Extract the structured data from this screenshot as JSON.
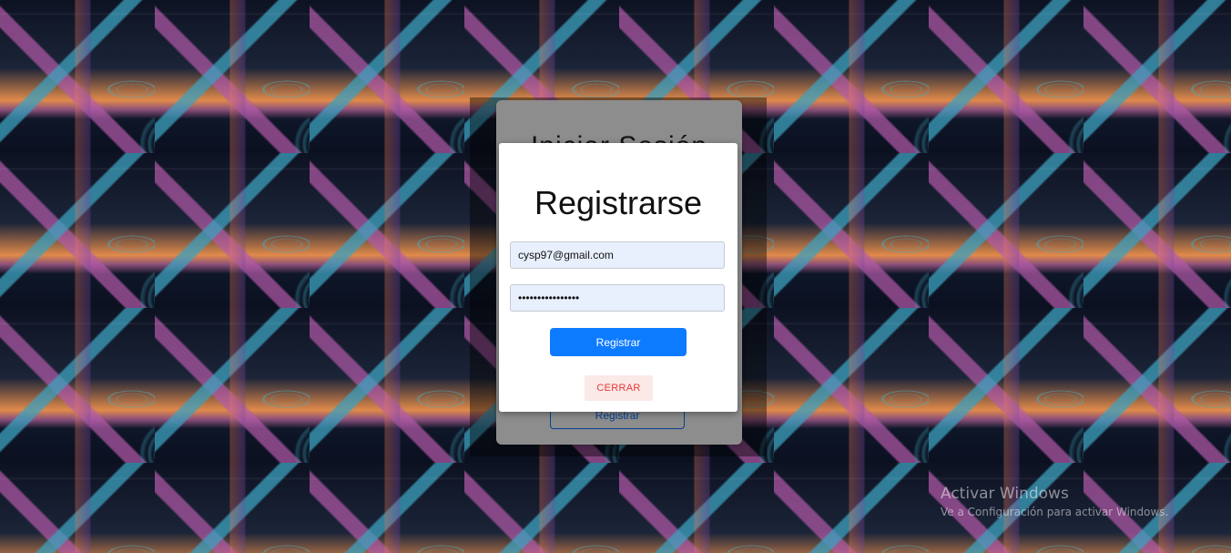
{
  "background": {
    "pattern": "abstract-architecture-tile"
  },
  "page": {
    "card_title": "Iniciar Sesión",
    "register_button": "Registrar"
  },
  "modal": {
    "title": "Registrarse",
    "email_value": "cysp97@gmail.com",
    "password_value": "cysp97@gmail.com",
    "register_button": "Registrar",
    "close_button": "CERRAR"
  },
  "watermark": {
    "title": "Activar Windows",
    "subtitle": "Ve a Configuración para activar Windows."
  },
  "colors": {
    "primary": "#0d7bff",
    "danger": "#e53935",
    "danger_bg": "#fbe9e7",
    "input_bg": "#e8f0fe"
  }
}
